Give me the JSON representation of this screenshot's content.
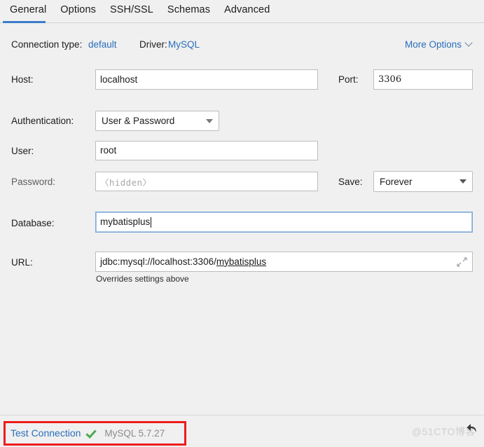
{
  "tabs": [
    {
      "label": "General",
      "active": true
    },
    {
      "label": "Options",
      "active": false
    },
    {
      "label": "SSH/SSL",
      "active": false
    },
    {
      "label": "Schemas",
      "active": false
    },
    {
      "label": "Advanced",
      "active": false
    }
  ],
  "info": {
    "connection_type_label": "Connection type:",
    "connection_type_value": "default",
    "driver_label": "Driver:",
    "driver_value": "MySQL",
    "more_options": "More Options",
    "chevron_icon": "chevron-down-icon"
  },
  "form": {
    "host_label": "Host:",
    "host_value": "localhost",
    "port_label": "Port:",
    "port_value": "3306",
    "authentication_label": "Authentication:",
    "authentication_value": "User & Password",
    "user_label": "User:",
    "user_value": "root",
    "password_label": "Password:",
    "password_placeholder": "〈hidden〉",
    "save_label": "Save:",
    "save_value": "Forever",
    "database_label": "Database:",
    "database_value": "mybatisplus",
    "url_label": "URL:",
    "url_prefix": "jdbc:mysql://localhost:3306/",
    "url_database": "mybatisplus",
    "url_expand_icon": "expand-diagonal-icon",
    "url_hint": "Overrides settings above"
  },
  "footer": {
    "test_connection": "Test Connection",
    "status_icon": "green-check-icon",
    "db_version": "MySQL 5.7.27",
    "watermark": "@51CTO博客",
    "cursor_icon": "back-arrow-cursor-icon"
  },
  "colors": {
    "accent_blue": "#2a6ebb",
    "tab_underline": "#3b7dcb",
    "focus_border": "#7ba7d7",
    "annotation_red": "#ee1c1c",
    "check_green": "#4fa84f",
    "background": "#f0f0f0"
  }
}
